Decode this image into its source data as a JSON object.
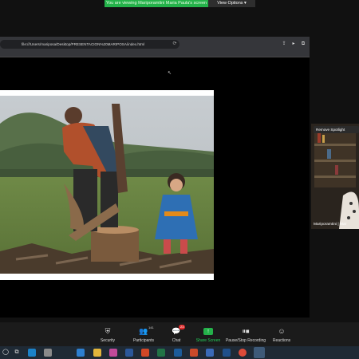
{
  "banner": {
    "message": "You are viewing Mariporamtini Maria Paula's screen",
    "view_options": "View Options ▾"
  },
  "browser": {
    "address": "file:///Users/mariposa/Desktop/PRESENTACION%20MARIPOSA/index.html"
  },
  "video_tile": {
    "spotlight_label": "Remove Spotlight",
    "participant_name": "Mariporamtini | Mar"
  },
  "controls": {
    "security": "Security",
    "participants": "Participants",
    "participants_count": "141",
    "chat": "Chat",
    "chat_badge": "23",
    "share_screen": "Share Screen",
    "record": "Pause/Stop Recording",
    "reactions": "Reactions"
  },
  "colors": {
    "share_green": "#24b24a",
    "control_bar": "#1b1b1b",
    "taskbar": "#1f2a35"
  }
}
